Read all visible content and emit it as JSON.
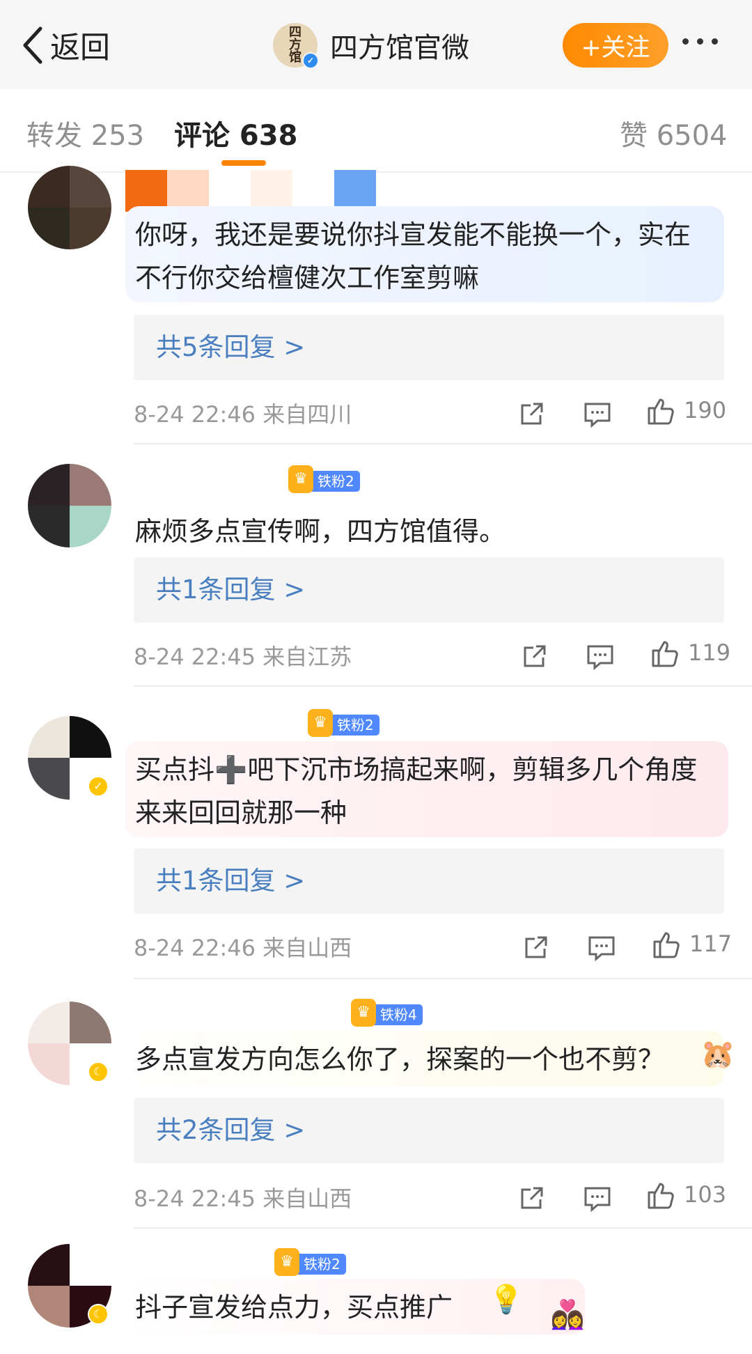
{
  "nav": {
    "back_label": "返回",
    "account_name": "四方馆官微",
    "logo_text": "四方馆",
    "follow_label": "+关注"
  },
  "tabs": {
    "repost_label": "转发 253",
    "comment_label": "评论 638",
    "like_label": "赞 6504"
  },
  "comments": [
    {
      "text": "你呀，我还是要说你抖宣发能不能换一个，实在不行你交给檀健次工作室剪嘛",
      "reply_label": "共5条回复 >",
      "meta": "8-24 22:46 来自四川",
      "likes": "190",
      "badge": ""
    },
    {
      "text": "麻烦多点宣传啊，四方馆值得。",
      "reply_label": "共1条回复 >",
      "meta": "8-24 22:45 来自江苏",
      "likes": "119",
      "badge": "铁粉2"
    },
    {
      "text": "买点抖➕吧下沉市场搞起来啊，剪辑多几个角度来来回回就那一种",
      "reply_label": "共1条回复 >",
      "meta": "8-24 22:46 来自山西",
      "likes": "117",
      "badge": "铁粉2"
    },
    {
      "text": "多点宣发方向怎么你了，探案的一个也不剪？",
      "reply_label": "共2条回复 >",
      "meta": "8-24 22:45 来自山西",
      "likes": "103",
      "badge": "铁粉4"
    },
    {
      "text": "抖子宣发给点力，买点推广",
      "badge": "铁粉2"
    }
  ],
  "colors": {
    "accent": "#ff8200",
    "reply_link": "#4a7fbf",
    "fan_badge": "#4f88ff"
  },
  "icons": [
    "chevron-left-icon",
    "verified-icon",
    "more-icon",
    "share-icon",
    "comment-icon",
    "like-icon"
  ]
}
